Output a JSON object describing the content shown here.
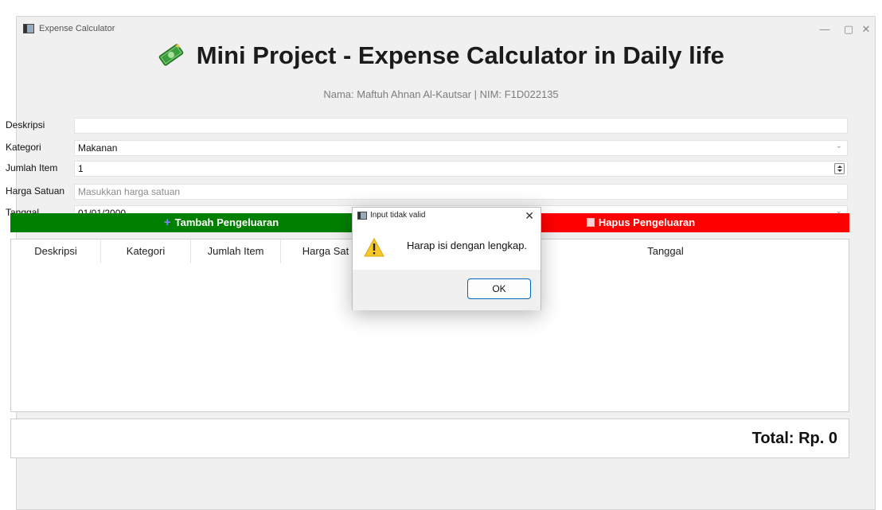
{
  "window": {
    "title": "Expense Calculator",
    "controls": {
      "minimize": "—",
      "maximize": "▢",
      "close": "✕"
    }
  },
  "header": {
    "title": "Mini Project - Expense Calculator in Daily life",
    "subtitle": "Nama: Maftuh Ahnan Al-Kautsar | NIM: F1D022135"
  },
  "form": {
    "deskripsi": {
      "label": "Deskripsi",
      "value": ""
    },
    "kategori": {
      "label": "Kategori",
      "value": "Makanan"
    },
    "jumlah_item": {
      "label": "Jumlah Item",
      "value": "1"
    },
    "harga_satuan": {
      "label": "Harga Satuan",
      "value": "",
      "placeholder": "Masukkan harga satuan"
    },
    "tanggal": {
      "label": "Tanggal",
      "value": "01/01/2000"
    }
  },
  "buttons": {
    "add": {
      "label": "Tambah Pengeluaran",
      "icon": "+",
      "color": "#008000"
    },
    "delete": {
      "label": "Hapus Pengeluaran",
      "color": "#ff0000"
    }
  },
  "table": {
    "columns": [
      "Deskripsi",
      "Kategori",
      "Jumlah Item",
      "Harga Sat",
      "",
      "Tanggal"
    ],
    "rows": []
  },
  "total": {
    "text": "Total: Rp. 0"
  },
  "dialog": {
    "title": "Input tidak valid",
    "message": "Harap isi dengan lengkap.",
    "ok_label": "OK",
    "close": "✕"
  }
}
